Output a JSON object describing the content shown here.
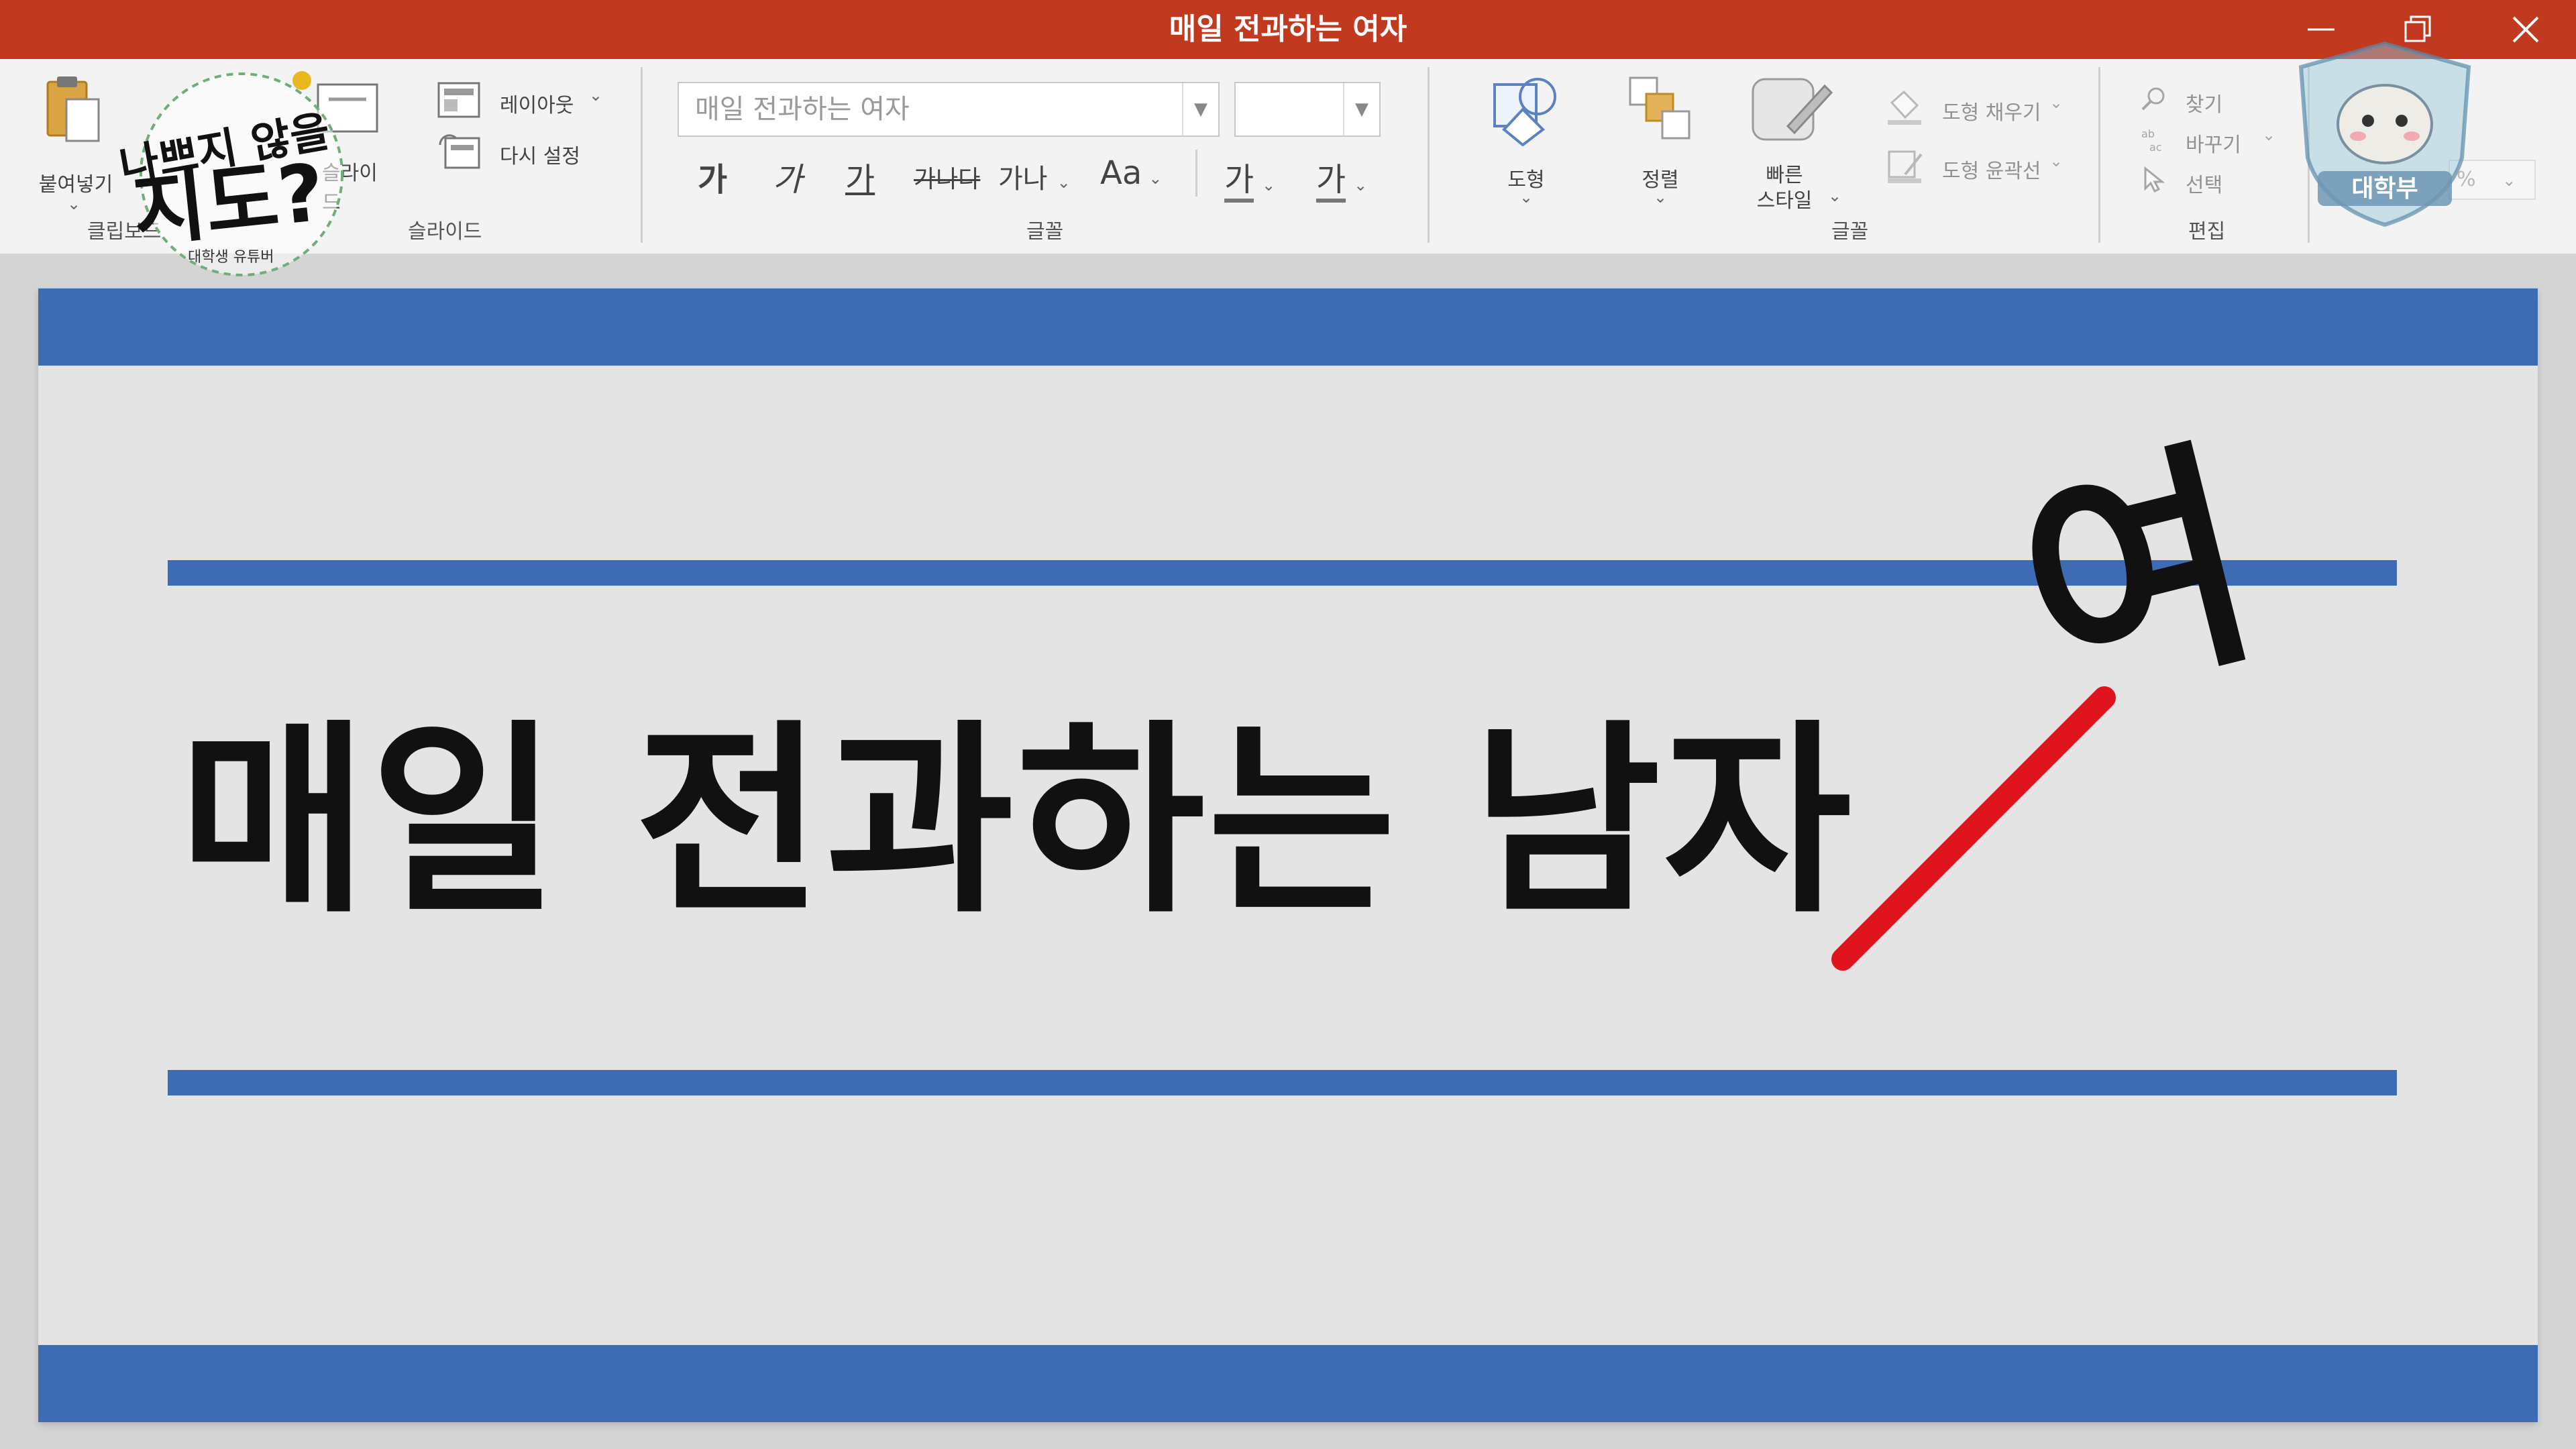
{
  "window": {
    "title": "매일 전과하는 여자",
    "minimize_icon": "minimize-icon",
    "restore_icon": "restore-icon",
    "close_icon": "close-icon"
  },
  "ribbon": {
    "clipboard": {
      "paste_label": "붙여넣기",
      "group_label": "클립보드"
    },
    "slides": {
      "new_slide_label": "슬라이드",
      "layout_label": "레이아웃",
      "reset_label": "다시 설정",
      "group_label": "슬라이드"
    },
    "font": {
      "font_name_value": "매일 전과하는 여자",
      "font_size_value": "",
      "bold_label": "가",
      "italic_label": "가",
      "underline_label": "가",
      "strike_label": "가나다",
      "spacing_label": "가나",
      "case_label": "Aa",
      "highlight_label": "가",
      "color_label": "가",
      "group_label": "글꼴"
    },
    "drawing": {
      "shapes_label": "도형",
      "arrange_label": "정렬",
      "quick_styles_label": "빠른\n스타일",
      "fill_label": "도형 채우기",
      "outline_label": "도형 윤곽선",
      "group_label": "글꼴"
    },
    "editing": {
      "find_label": "찾기",
      "replace_label": "바꾸기",
      "select_label": "선택",
      "group_label": "편집"
    },
    "zoom_value": "%"
  },
  "slide": {
    "headline": "매일 전과하는 남자",
    "headline_prefix": "매일 전과하는 ",
    "struck_char": "남",
    "last_char": "자",
    "correction_char": "여",
    "colors": {
      "band": "#3d6cb5",
      "strike": "#e0141e",
      "text": "#111111"
    }
  },
  "overlays": {
    "channel_logo_text_top": "나쁘지 않을",
    "channel_logo_text_main": "지도?",
    "channel_logo_sub": "대학생 유튜버",
    "badge_label": "대학부"
  }
}
